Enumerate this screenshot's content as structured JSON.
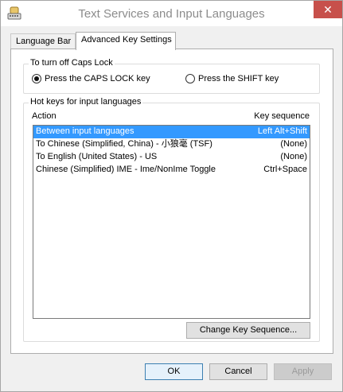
{
  "window": {
    "title": "Text Services and Input Languages",
    "close_symbol": "✕",
    "accent": "#c7504b"
  },
  "tabs": [
    {
      "label": "Language Bar"
    },
    {
      "label": "Advanced Key Settings"
    }
  ],
  "caps_lock": {
    "group_label": "To turn off Caps Lock",
    "options": [
      {
        "label": "Press the CAPS LOCK key",
        "checked": true
      },
      {
        "label": "Press the SHIFT key",
        "checked": false
      }
    ]
  },
  "hotkeys": {
    "group_label": "Hot keys for input languages",
    "columns": {
      "action": "Action",
      "sequence": "Key sequence"
    },
    "rows": [
      {
        "action": "Between input languages",
        "sequence": "Left Alt+Shift",
        "selected": true
      },
      {
        "action": "To Chinese (Simplified, China) - 小狼毫 (TSF)",
        "sequence": "(None)",
        "selected": false
      },
      {
        "action": "To English (United States) - US",
        "sequence": "(None)",
        "selected": false
      },
      {
        "action": "Chinese (Simplified) IME - Ime/NonIme Toggle",
        "sequence": "Ctrl+Space",
        "selected": false
      }
    ],
    "change_button": "Change Key Sequence..."
  },
  "buttons": {
    "ok": "OK",
    "cancel": "Cancel",
    "apply": "Apply"
  },
  "selection_color": "#3399ff"
}
